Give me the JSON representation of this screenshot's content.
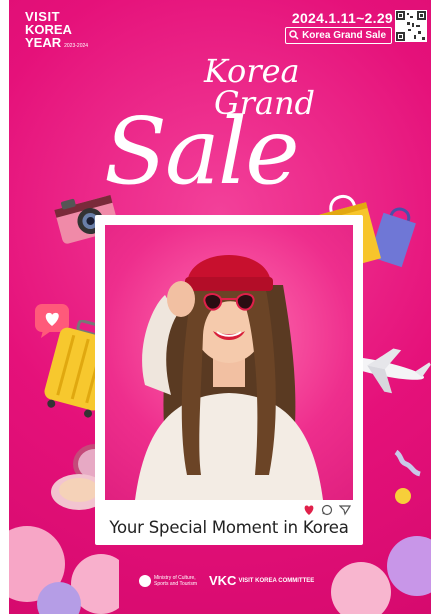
{
  "brand": {
    "logo_line1": "VISIT",
    "logo_line2": "KOREA",
    "logo_line3": "YEAR",
    "logo_years": "2023-2024"
  },
  "header": {
    "dates": "2024.1.11~2.29",
    "search_label": "Korea Grand Sale"
  },
  "title": {
    "line1": "Korea",
    "line2": "Grand",
    "line3": "Sale"
  },
  "frame": {
    "caption": "Your Special Moment in Korea"
  },
  "footer": {
    "ministry": "Ministry of Culture, Sports and Tourism",
    "committee": "VISIT KOREA COMMITTEE",
    "committee_mark": "VKC"
  },
  "colors": {
    "background": "#e5117a",
    "accent": "#ffffff",
    "caption_text": "#222222"
  },
  "icons": [
    "search-icon",
    "qr-code-icon",
    "heart-icon",
    "comment-icon",
    "send-icon",
    "camera-icon",
    "shopping-bag-icon",
    "suitcase-icon",
    "airplane-icon",
    "compact-icon",
    "balloon-icon"
  ]
}
